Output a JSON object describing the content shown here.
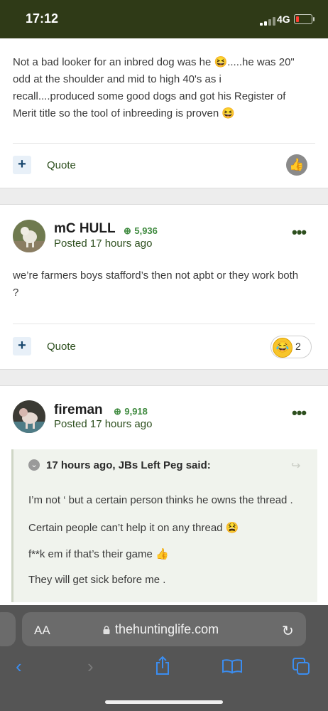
{
  "status_bar": {
    "time": "17:12",
    "network": "4G"
  },
  "post1": {
    "lines": [
      "Not a bad looker for an inbred dog was he 😆.....he was 20\"",
      "odd at the shoulder and mid to high 40's as i",
      "recall....produced some good dogs and got his Register of",
      "Merit title so the tool of inbreeding is proven 😆"
    ],
    "actions": {
      "plus": "+",
      "quote": "Quote",
      "like_icon": "thumbs-up-icon"
    }
  },
  "post2": {
    "author": "mC HULL",
    "reputation": "5,936",
    "posted": "Posted 17 hours ago",
    "menu": "•••",
    "lines": [
      "we’re farmers boys stafford’s then not apbt or they work both",
      "?"
    ],
    "actions": {
      "plus": "+",
      "quote": "Quote",
      "reaction_emoji": "😂",
      "reaction_count": "2"
    }
  },
  "post3": {
    "author": "fireman",
    "reputation": "9,918",
    "posted": "Posted 17 hours ago",
    "menu": "•••",
    "quote": {
      "header": "17 hours ago, JBs Left Peg said:",
      "lines": [
        "I’m not ‘ but a certain person thinks he owns the thread .",
        "Certain people can’t help it on any thread 😫",
        "f**k em if that’s their game 👍",
        "They will get sick before me ."
      ]
    }
  },
  "browser": {
    "aa_label": "AA",
    "url": "thehuntinglife.com",
    "icons": [
      "back-icon",
      "forward-icon",
      "share-icon",
      "bookmarks-icon",
      "tabs-icon"
    ]
  }
}
